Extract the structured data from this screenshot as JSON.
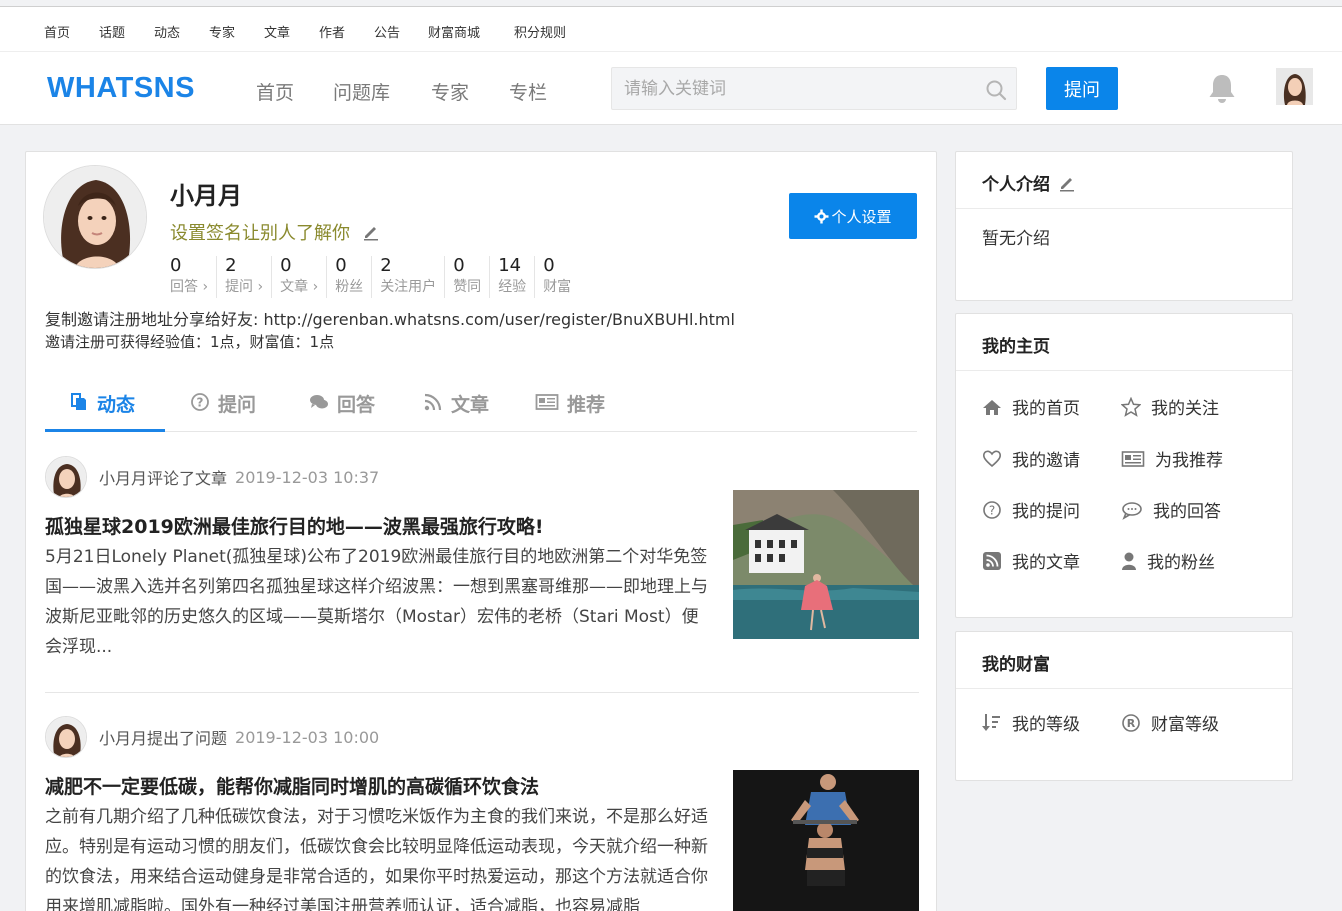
{
  "topnav": [
    "首页",
    "话题",
    "动态",
    "专家",
    "文章",
    "作者",
    "公告",
    "财富商城",
    "积分规则"
  ],
  "header": {
    "logo": "WHATSNS",
    "nav": [
      "首页",
      "问题库",
      "专家",
      "专栏"
    ],
    "search_placeholder": "请输入关键词",
    "ask_label": "提问"
  },
  "profile": {
    "name": "小月月",
    "signature": "设置签名让别人了解你",
    "settings_label": "个人设置",
    "stats": [
      {
        "num": "0",
        "label": "回答 ›"
      },
      {
        "num": "2",
        "label": "提问 ›"
      },
      {
        "num": "0",
        "label": "文章 ›"
      },
      {
        "num": "0",
        "label": "粉丝"
      },
      {
        "num": "2",
        "label": "关注用户"
      },
      {
        "num": "0",
        "label": "赞同"
      },
      {
        "num": "14",
        "label": "经验"
      },
      {
        "num": "0",
        "label": "财富"
      }
    ],
    "invite_line": "复制邀请注册地址分享给好友:   http://gerenban.whatsns.com/user/register/BnuXBUHl.html",
    "invite_reward": "邀请注册可获得经验值：1点，财富值：1点"
  },
  "tabs": [
    "动态",
    "提问",
    "回答",
    "文章",
    "推荐"
  ],
  "feed": [
    {
      "action": "小月月评论了文章",
      "time": "2019-12-03 10:37",
      "title": "孤独星球2019欧洲最佳旅行目的地——波黑最强旅行攻略!",
      "desc": "5月21日Lonely Planet(孤独星球)公布了2019欧洲最佳旅行目的地欧洲第二个对华免签国——波黑入选并名列第四名孤独星球这样介绍波黑：一想到黑塞哥维那——即地理上与波斯尼亚毗邻的历史悠久的区域——莫斯塔尔（Mostar）宏伟的老桥（Stari Most）便会浮现..."
    },
    {
      "action": "小月月提出了问题",
      "time": "2019-12-03 10:00",
      "title": "减肥不一定要低碳，能帮你减脂同时增肌的高碳循环饮食法",
      "desc": "之前有几期介绍了几种低碳饮食法，对于习惯吃米饭作为主食的我们来说，不是那么好适应。特别是有运动习惯的朋友们，低碳饮食会比较明显降低运动表现，今天就介绍一种新的饮食法，用来结合运动健身是非常合适的，如果你平时热爱运动，那这个方法就适合你用来增肌减脂啦。国外有一种经过美国注册营养师认证，适合减脂，也容易减脂"
    }
  ],
  "sidebar": {
    "intro_title": "个人介绍",
    "intro_text": "暂无介绍",
    "home_title": "我的主页",
    "home_items": [
      "我的首页",
      "我的关注",
      "我的邀请",
      "为我推荐",
      "我的提问",
      "我的回答",
      "我的文章",
      "我的粉丝"
    ],
    "wealth_title": "我的财富",
    "wealth_items": [
      "我的等级",
      "财富等级"
    ]
  },
  "colors": {
    "accent": "#0a85ea",
    "signature": "#8a8a2e"
  }
}
